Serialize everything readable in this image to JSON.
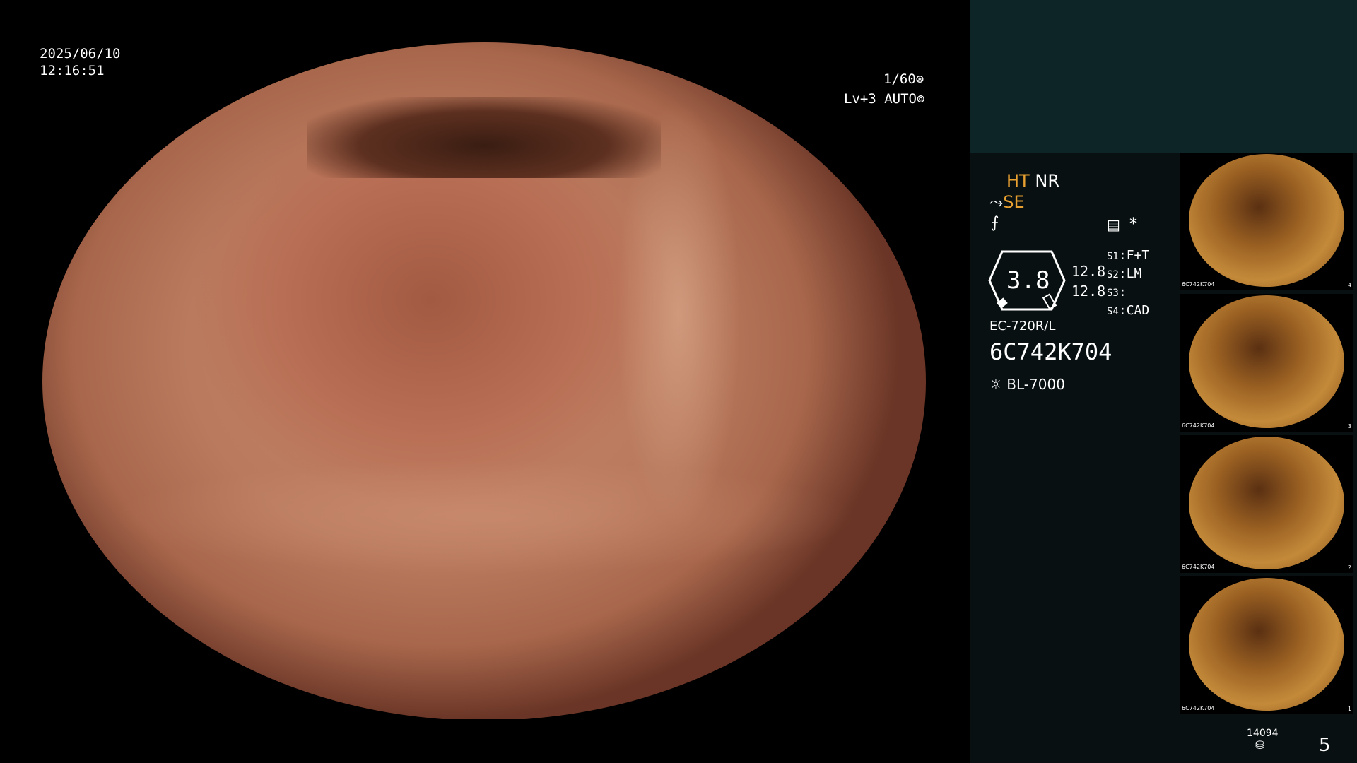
{
  "osd": {
    "date": "2025/06/10",
    "time": "12:16:51",
    "shutter": "1/60",
    "level": "Lv+3",
    "mode": "AUTO"
  },
  "panel": {
    "ht": "HT",
    "nr": "NR",
    "se": "SE",
    "gauge_value": "3.8",
    "val1": "12.8",
    "val2": "12.8",
    "s1_label": "S1",
    "s1_value": "F+T",
    "s2_label": "S2",
    "s2_value": "LM",
    "s3_label": "S3",
    "s3_value": "",
    "s4_label": "S4",
    "s4_value": "CAD",
    "scope_model": "EC-720R/L",
    "serial": "6C742K704",
    "light_source": "BL-7000",
    "storage_count": "14094",
    "page": "5"
  },
  "thumbnails": [
    {
      "caption": "6C742K704",
      "index": "4"
    },
    {
      "caption": "6C742K704",
      "index": "3"
    },
    {
      "caption": "6C742K704",
      "index": "2"
    },
    {
      "caption": "6C742K704",
      "index": "1"
    }
  ],
  "icons": {
    "shutter": "aperture-icon",
    "auto": "auto-iris-icon",
    "light": "lamp-icon",
    "storage": "database-icon",
    "record": "record-icon",
    "asterisk": "asterisk-icon"
  },
  "colors": {
    "accent": "#e8a030",
    "panel_top": "#0d2527",
    "panel_bg": "#081012"
  }
}
